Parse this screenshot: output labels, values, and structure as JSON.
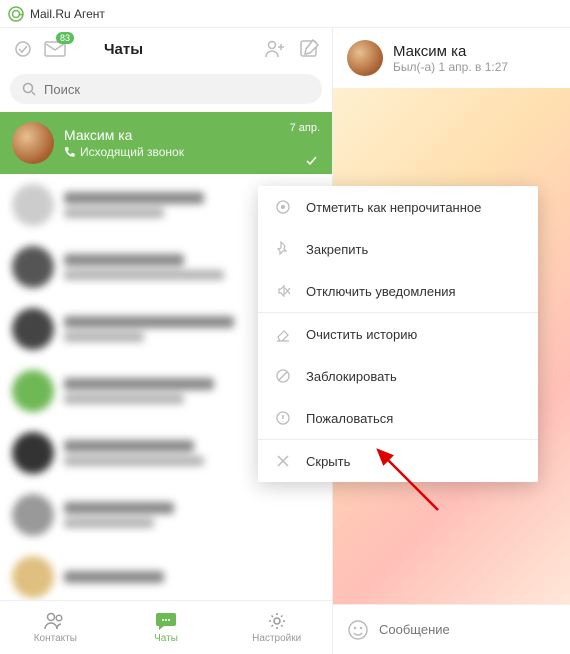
{
  "appTitle": "Mail.Ru Агент",
  "header": {
    "title": "Чаты",
    "unreadBadge": "83"
  },
  "search": {
    "placeholder": "Поиск"
  },
  "selectedChat": {
    "name": "Максим ка",
    "subtitle": "Исходящий звонок",
    "date": "7 апр."
  },
  "blurNames": [
    "",
    "",
    "",
    "",
    "",
    "",
    ""
  ],
  "contextMenu": {
    "markUnread": "Отметить как непрочитанное",
    "pin": "Закрепить",
    "mute": "Отключить уведомления",
    "clearHistory": "Очистить историю",
    "block": "Заблокировать",
    "report": "Пожаловаться",
    "hide": "Скрыть"
  },
  "tabs": {
    "contacts": "Контакты",
    "chats": "Чаты",
    "settings": "Настройки"
  },
  "rightPane": {
    "name": "Максим ка",
    "status": "Был(-а) 1 апр. в 1:27",
    "inputPlaceholder": "Сообщение"
  }
}
